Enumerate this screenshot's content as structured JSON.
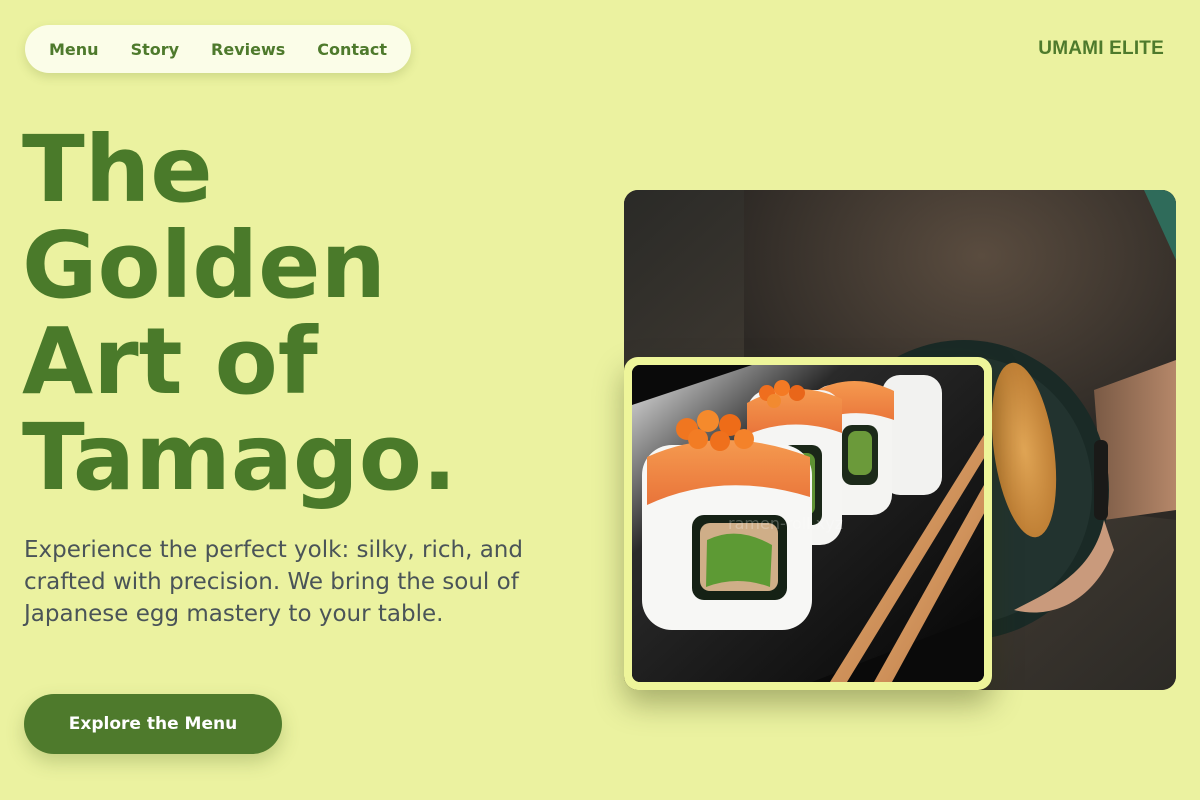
{
  "nav": {
    "items": [
      {
        "label": "Menu"
      },
      {
        "label": "Story"
      },
      {
        "label": "Reviews"
      },
      {
        "label": "Contact"
      }
    ]
  },
  "brand": "UMAMI ELITE",
  "hero": {
    "title_lines": [
      "The",
      "Golden",
      "Art of",
      "Tamago."
    ],
    "subtitle": "Experience the perfect yolk: silky, rich, and crafted with precision. We bring the soul of Japanese egg mastery to your table.",
    "cta_label": "Explore the Menu"
  },
  "images": {
    "main": "hand-holding-plate-of-fried-sushi",
    "inset": "salmon-roe-sushi-rolls-with-chopsticks",
    "watermark": "ramen-roll.xyz"
  },
  "colors": {
    "background": "#ebf2a0",
    "accent": "#4e7a2c",
    "text": "#4a5458"
  }
}
